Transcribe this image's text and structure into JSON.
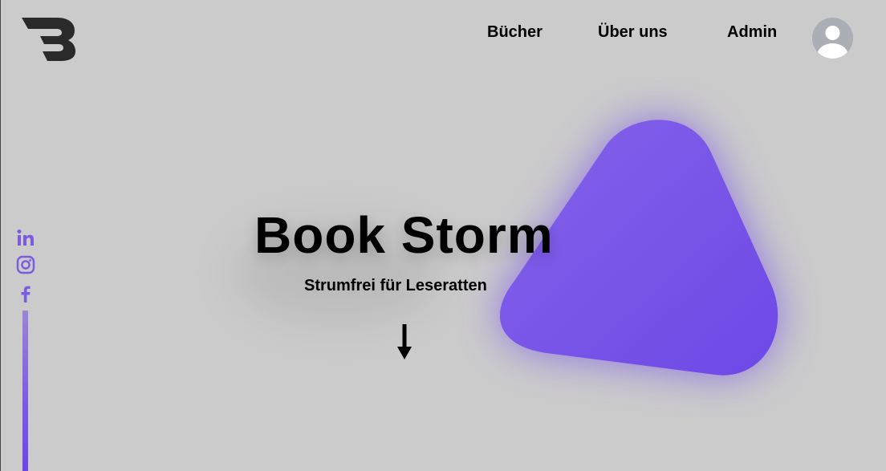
{
  "brand": {
    "logo_letter": "B",
    "logo_color": "#2a2a2a"
  },
  "nav": {
    "items": [
      {
        "label": "Bücher"
      },
      {
        "label": "Über uns"
      },
      {
        "label": "Admin"
      }
    ],
    "avatar_icon": "user-avatar-icon"
  },
  "hero": {
    "title": "Book Storm",
    "subtitle": "Strumfrei für Leseratten",
    "scroll_icon": "arrow-down-icon"
  },
  "social": {
    "links": [
      {
        "icon": "linkedin-icon"
      },
      {
        "icon": "instagram-icon"
      },
      {
        "icon": "facebook-icon"
      }
    ]
  },
  "colors": {
    "background": "#cbcbcb",
    "accent": "#7550e5",
    "text": "#000000"
  }
}
